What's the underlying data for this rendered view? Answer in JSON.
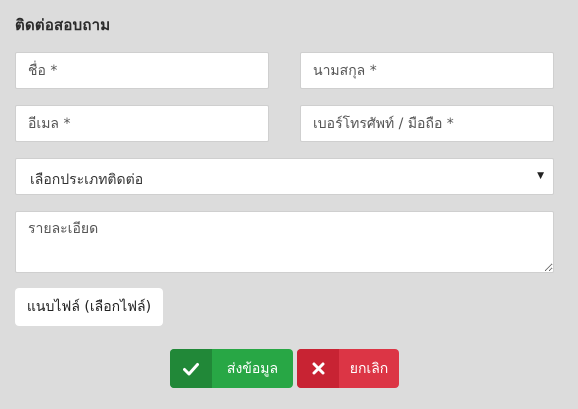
{
  "form": {
    "title": "ติดต่อสอบถาม",
    "first_name": {
      "placeholder": "ชื่อ *",
      "value": ""
    },
    "last_name": {
      "placeholder": "นามสกุล *",
      "value": ""
    },
    "email": {
      "placeholder": "อีเมล *",
      "value": ""
    },
    "phone": {
      "placeholder": "เบอร์โทรศัพท์ / มือถือ *",
      "value": ""
    },
    "contact_type": {
      "selected": "เลือกประเภทติดต่อ"
    },
    "details": {
      "placeholder": "รายละเอียด",
      "value": ""
    },
    "attach_label": "แนบไฟล์ (เลือกไฟล์)"
  },
  "actions": {
    "submit_label": "ส่งข้อมูล",
    "submit_icon": "check-icon",
    "cancel_label": "ยกเลิก",
    "cancel_icon": "close-icon"
  },
  "colors": {
    "background": "#dcdcdc",
    "submit": "#28a745",
    "cancel": "#dc3545"
  }
}
